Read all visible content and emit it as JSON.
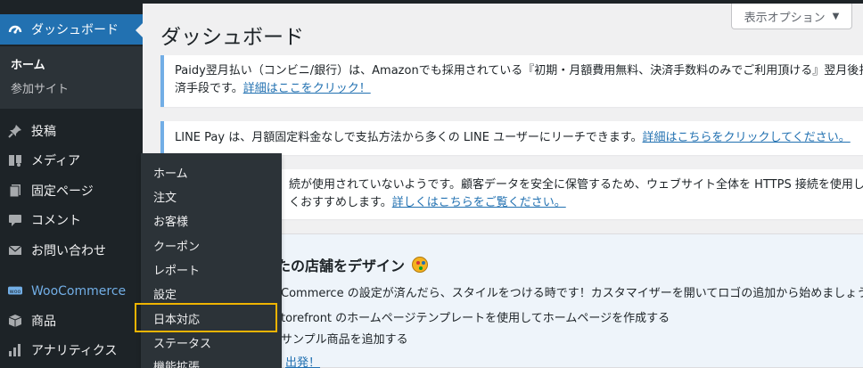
{
  "sidebar": {
    "dashboard_label": "ダッシュボード",
    "submenu": {
      "home": "ホーム",
      "sites": "参加サイト"
    },
    "items": [
      {
        "label": "投稿",
        "icon": "pin-icon"
      },
      {
        "label": "メディア",
        "icon": "media-icon"
      },
      {
        "label": "固定ページ",
        "icon": "page-icon"
      },
      {
        "label": "コメント",
        "icon": "comment-icon"
      },
      {
        "label": "お問い合わせ",
        "icon": "mail-icon"
      },
      {
        "label": "WooCommerce",
        "icon": "woocommerce-icon"
      },
      {
        "label": "商品",
        "icon": "box-icon"
      },
      {
        "label": "アナリティクス",
        "icon": "bar-chart-icon"
      }
    ]
  },
  "flyout": {
    "items": [
      "ホーム",
      "注文",
      "お客様",
      "クーポン",
      "レポート",
      "設定",
      "日本対応",
      "ステータス",
      "機能拡張"
    ],
    "highlighted": "日本対応"
  },
  "header": {
    "screen_options": "表示オプション",
    "page_title": "ダッシュボード"
  },
  "notices": {
    "paidy_line1": "Paidy翌月払い（コンビニ/銀行）は、Amazonでも採用されている『初期・月額費用無料、決済手数料のみでご利用頂ける』翌月後払",
    "paidy_line2": "済手段です。",
    "paidy_link": "詳細はここをクリック！",
    "linepay_text": "LINE Pay は、月額固定料金なしで支払方法から多くの LINE ユーザーにリーチできます。",
    "linepay_link": "詳細はこちらをクリックしてください。",
    "https_line1": "続が使用されていないようです。顧客データを安全に保管するため、ウェブサイト全体を HTTPS 接続を使用し",
    "https_line2": "くおすすめします。",
    "https_link": "詳しくはこちらをご覧ください。"
  },
  "design": {
    "title": "たの店舗をデザイン",
    "line1": "Commerce の設定が済んだら、スタイルをつける時です！カスタマイザーを開いてロゴの追加から始めましょう。",
    "line2": "torefront のホームページテンプレートを使用してホームページを作成する",
    "line3": "サンプル商品を追加する",
    "link": "出発！"
  },
  "colors": {
    "sidebar_bg": "#1d2327",
    "active_bg": "#2271b1",
    "link": "#2271b1",
    "highlight_border": "#f0b400",
    "notice_border": "#72aee6"
  }
}
